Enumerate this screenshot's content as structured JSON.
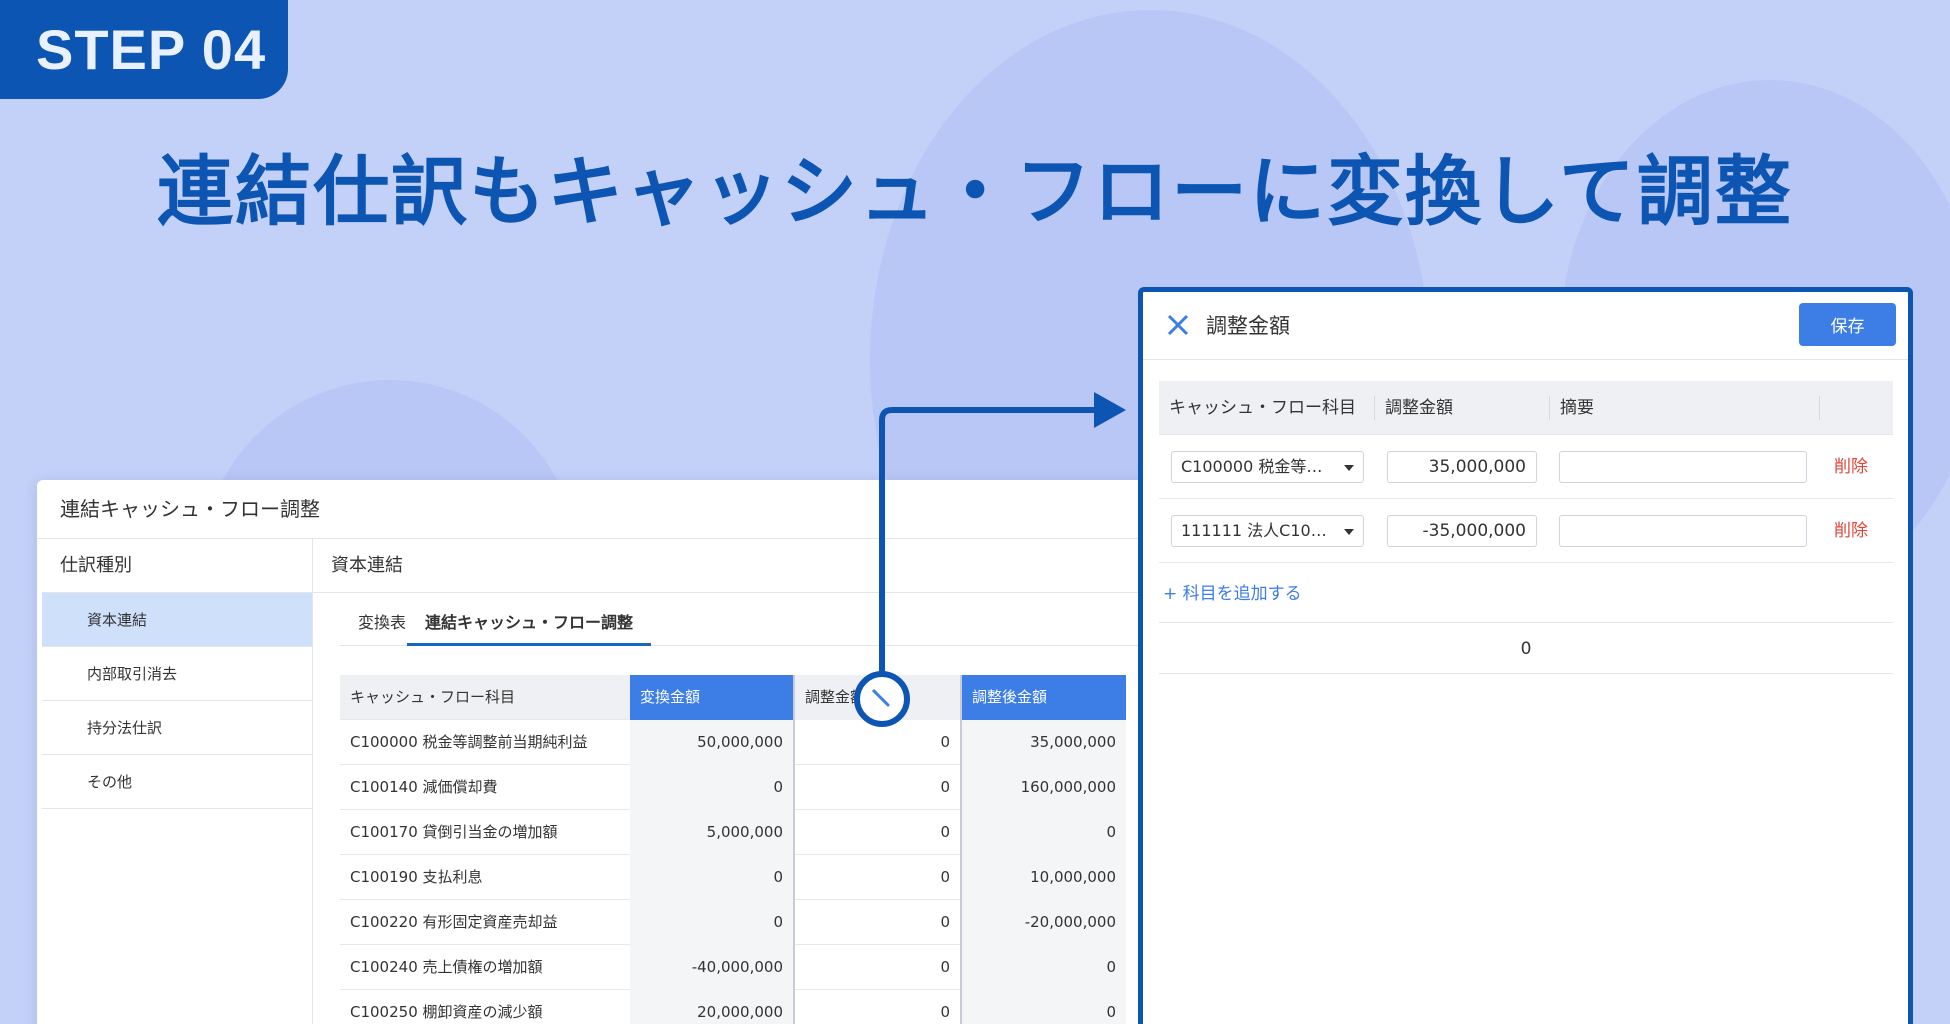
{
  "step_badge": "STEP 04",
  "headline": "連結仕訳もキャッシュ・フローに変換して調整",
  "main": {
    "title": "連結キャッシュ・フロー調整",
    "sidebar": {
      "header": "仕訳種別",
      "items": [
        "資本連結",
        "内部取引消去",
        "持分法仕訳",
        "その他"
      ]
    },
    "content_header": "資本連結",
    "tabs": [
      "変換表",
      "連結キャッシュ・フロー調整"
    ],
    "table": {
      "columns": [
        "キャッシュ・フロー科目",
        "変換金額",
        "調整金額",
        "調整後金額"
      ],
      "rows": [
        [
          "C100000 税金等調整前当期純利益",
          "50,000,000",
          "0",
          "35,000,000"
        ],
        [
          "C100140 減価償却費",
          "0",
          "0",
          "160,000,000"
        ],
        [
          "C100170 貸倒引当金の増加額",
          "5,000,000",
          "0",
          "0"
        ],
        [
          "C100190 支払利息",
          "0",
          "0",
          "10,000,000"
        ],
        [
          "C100220 有形固定資産売却益",
          "0",
          "0",
          "-20,000,000"
        ],
        [
          "C100240 売上債権の増加額",
          "-40,000,000",
          "0",
          "0"
        ],
        [
          "C100250 棚卸資産の減少額",
          "20,000,000",
          "0",
          "0"
        ]
      ]
    },
    "edit_icon": "pencil-icon"
  },
  "dialog": {
    "title": "調整金額",
    "save_label": "保存",
    "close_icon": "close-icon",
    "columns": [
      "キャッシュ・フロー科目",
      "調整金額",
      "摘要"
    ],
    "rows": [
      {
        "account": "C100000 税金等…",
        "amount": "35,000,000",
        "note": "",
        "delete": "削除"
      },
      {
        "account": "111111 法人C10…",
        "amount": "-35,000,000",
        "note": "",
        "delete": "削除"
      }
    ],
    "add_label": "+ 科目を追加する",
    "total": "0"
  },
  "colors": {
    "background": "#c3d0f8",
    "brand": "#0d55b3",
    "accent": "#3c7de6",
    "danger": "#e0453c"
  }
}
